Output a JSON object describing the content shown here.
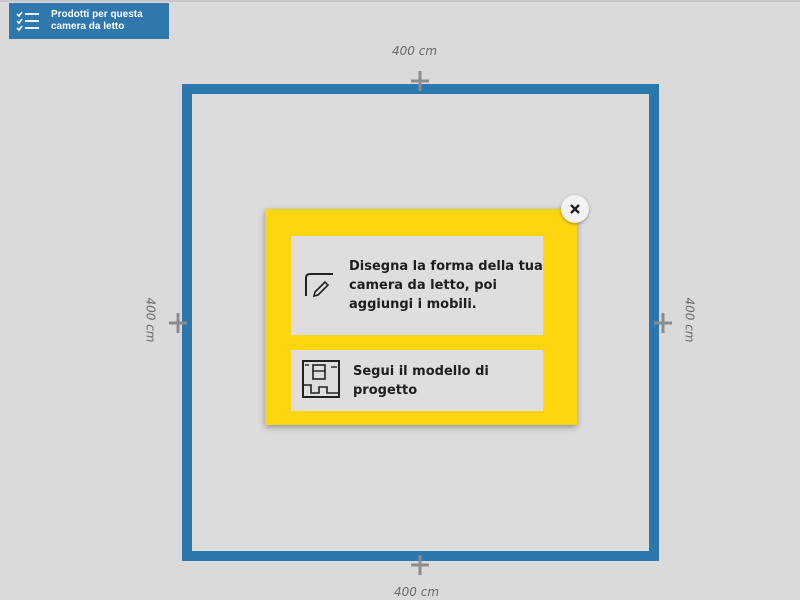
{
  "toolbar": {
    "products_button_label": "Prodotti per questa camera da letto",
    "products_icon": "checklist-icon"
  },
  "room": {
    "dimension_top": "400 cm",
    "dimension_bottom": "400 cm",
    "dimension_left": "400 cm",
    "dimension_right": "400 cm",
    "wall_color": "#2a78ad",
    "handle_icon": "move-handle-icon"
  },
  "popup": {
    "background_color": "#ffd50f",
    "close_icon": "close-icon",
    "options": [
      {
        "label": "Disegna la forma della tua camera da letto, poi aggiungi i mobili.",
        "icon": "draw-shape-icon"
      },
      {
        "label": "Segui il modello di progetto",
        "icon": "floor-plan-template-icon"
      }
    ]
  }
}
